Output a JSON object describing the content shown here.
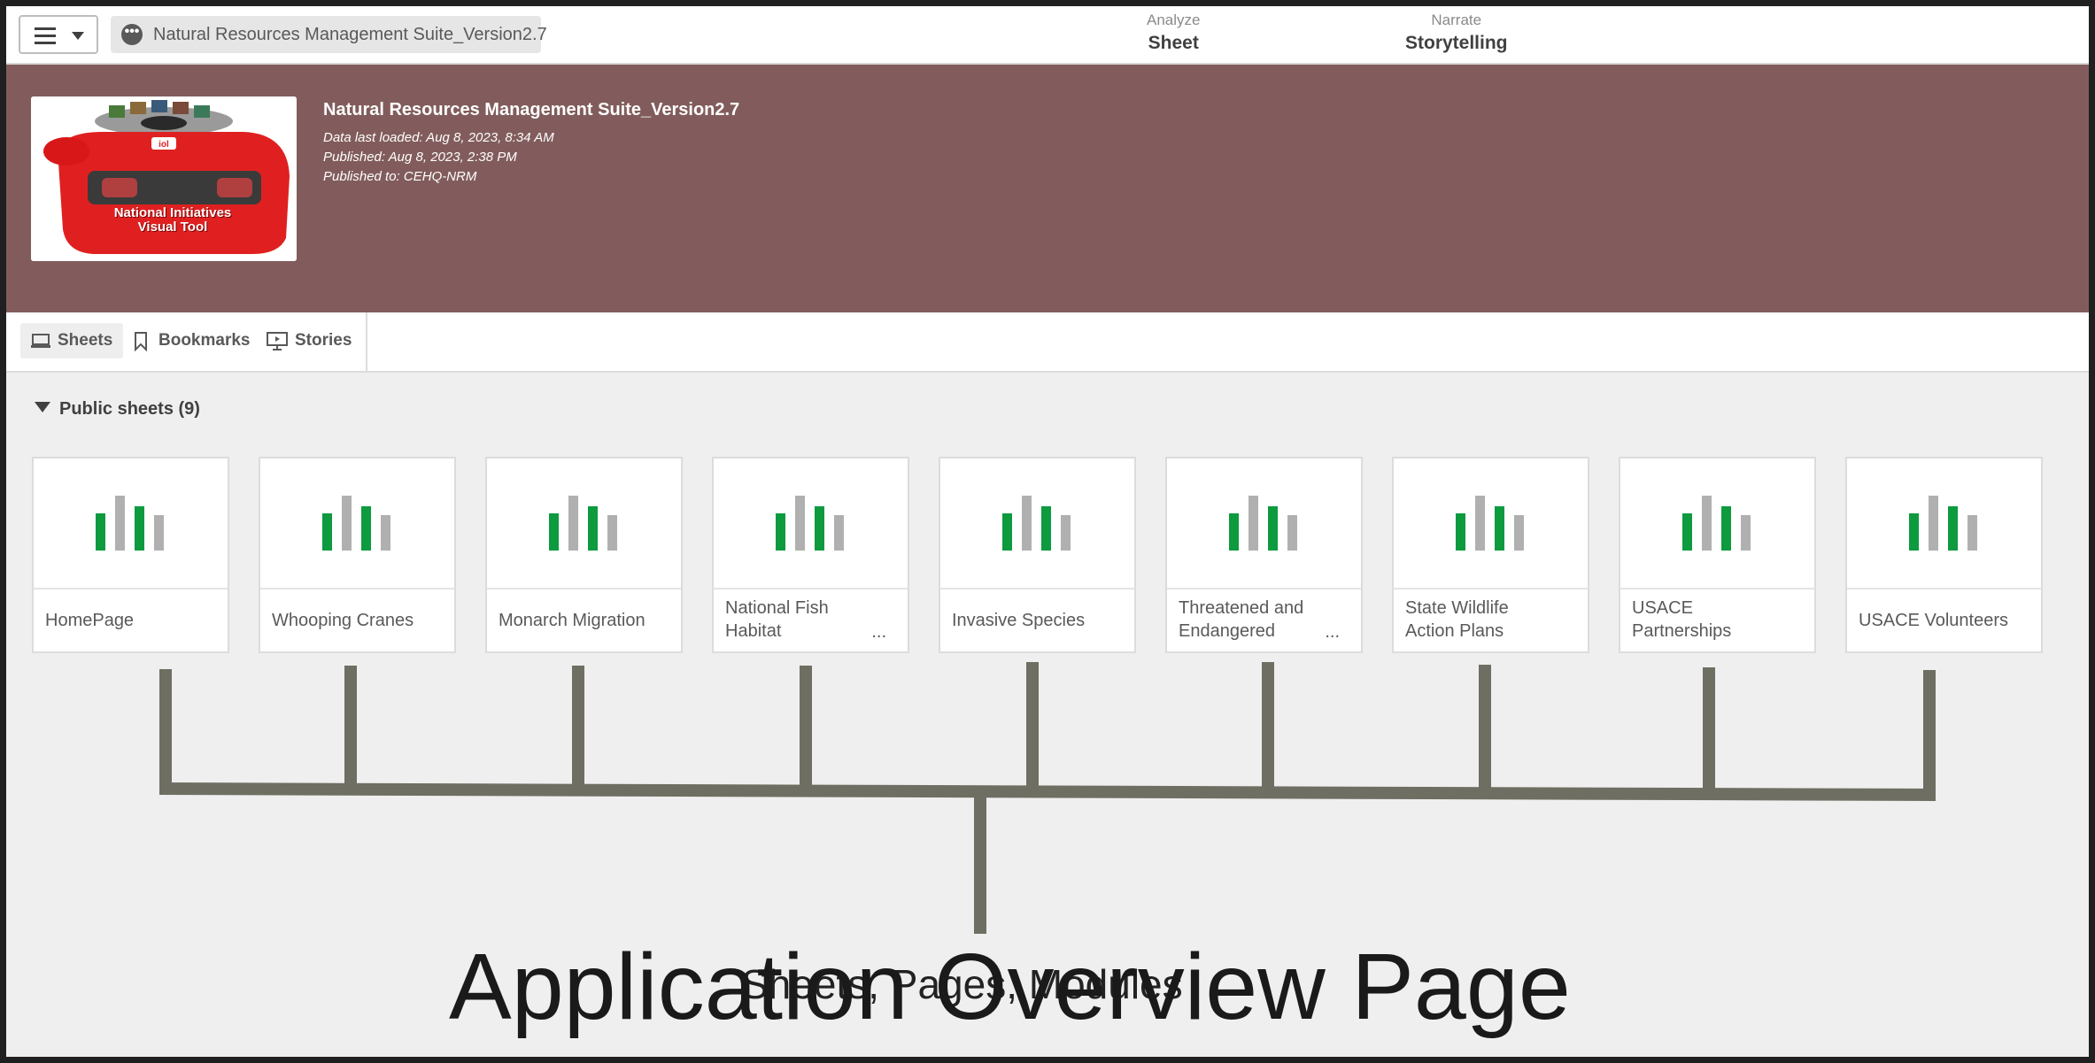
{
  "topbar": {
    "app_name": "Natural Resources Management Suite_Version2.7",
    "nav_analyze_small": "Analyze",
    "nav_analyze_big": "Sheet",
    "nav_narrate_small": "Narrate",
    "nav_narrate_big": "Storytelling"
  },
  "banner": {
    "title": "Natural Resources Management Suite_Version2.7",
    "data_loaded": "Data last loaded: Aug 8, 2023, 8:34 AM",
    "published": "Published: Aug 8, 2023, 2:38 PM",
    "published_to": "Published to: CEHQ-NRM",
    "thumb_text_line1": "National Initiatives",
    "thumb_text_line2": "Visual Tool"
  },
  "tabs": {
    "sheets": "Sheets",
    "bookmarks": "Bookmarks",
    "stories": "Stories"
  },
  "section": {
    "label": "Public sheets (9)"
  },
  "sheets": [
    {
      "line1": "HomePage",
      "line2": "",
      "ellipsis": ""
    },
    {
      "line1": "Whooping Cranes",
      "line2": "",
      "ellipsis": ""
    },
    {
      "line1": "Monarch Migration",
      "line2": "",
      "ellipsis": ""
    },
    {
      "line1": "National Fish",
      "line2": "Habitat",
      "ellipsis": "..."
    },
    {
      "line1": "Invasive Species",
      "line2": "",
      "ellipsis": ""
    },
    {
      "line1": "Threatened and",
      "line2": "Endangered",
      "ellipsis": "..."
    },
    {
      "line1": "State Wildlife",
      "line2": "Action Plans",
      "ellipsis": ""
    },
    {
      "line1": "USACE",
      "line2": "Partnerships",
      "ellipsis": ""
    },
    {
      "line1": "USACE Volunteers",
      "line2": "",
      "ellipsis": ""
    }
  ],
  "annotation": {
    "caption_big": "Application Overview Page",
    "caption_small": "Sheets, Pages, Modules"
  },
  "colors": {
    "banner": "#825c5c",
    "bar_green": "#0e9a3e",
    "bar_gray": "#b0b0b0",
    "connector": "#6e6e62"
  }
}
